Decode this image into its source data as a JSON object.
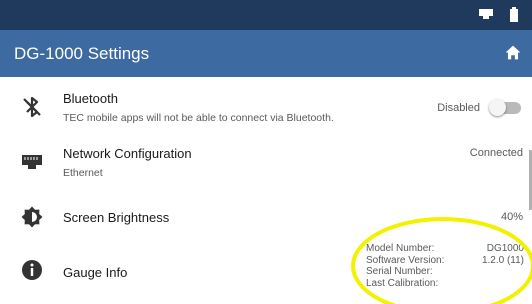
{
  "status_bar": {
    "icons": [
      "network-icon",
      "battery-icon"
    ]
  },
  "app_bar": {
    "title": "DG-1000 Settings",
    "home_icon": "home-icon"
  },
  "settings": [
    {
      "id": "bluetooth",
      "icon": "bluetooth-disabled-icon",
      "title": "Bluetooth",
      "subtitle": "TEC mobile apps will not be able to connect via Bluetooth.",
      "value": "Disabled",
      "toggle_on": false
    },
    {
      "id": "network",
      "icon": "ethernet-icon",
      "title": "Network Configuration",
      "subtitle": "Ethernet",
      "value": "Connected"
    },
    {
      "id": "brightness",
      "icon": "brightness-icon",
      "title": "Screen Brightness",
      "value": "40%"
    },
    {
      "id": "gauge",
      "icon": "info-icon",
      "title": "Gauge Info"
    }
  ],
  "gauge_info": {
    "model_label": "Model Number:",
    "model_value": "DG1000",
    "software_label": "Software Version:",
    "software_value": "1.2.0 (11)",
    "serial_label": "Serial Number:",
    "serial_value": "",
    "calibration_label": "Last Calibration:",
    "calibration_value": ""
  },
  "colors": {
    "status_bar": "#1f3a5c",
    "app_bar": "#3d6aa0",
    "highlight": "#f2f200"
  }
}
